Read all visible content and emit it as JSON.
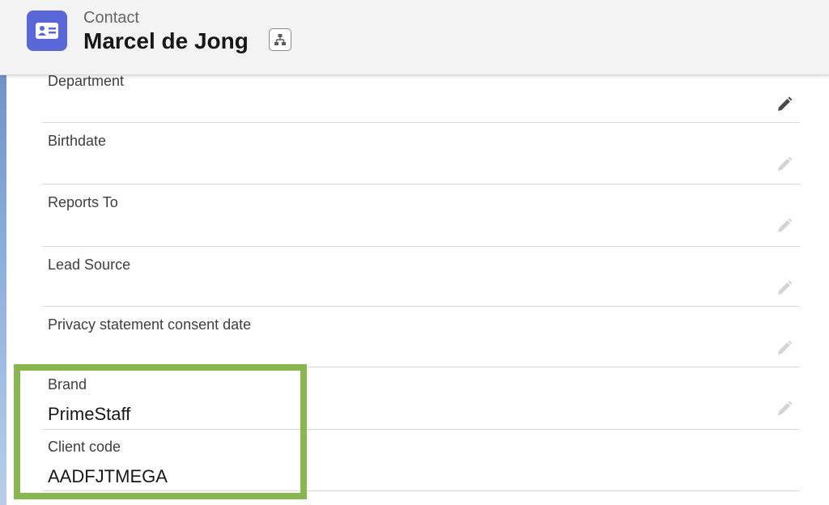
{
  "header": {
    "object_label": "Contact",
    "record_name": "Marcel de Jong",
    "record_icon": "contact-card-icon",
    "hierarchy_icon": "hierarchy-icon",
    "accent_color": "#5a67d8"
  },
  "fields": {
    "department": {
      "label": "Department",
      "value": ""
    },
    "birthdate": {
      "label": "Birthdate",
      "value": ""
    },
    "reports_to": {
      "label": "Reports To",
      "value": ""
    },
    "lead_source": {
      "label": "Lead Source",
      "value": ""
    },
    "privacy_consent_date": {
      "label": "Privacy statement consent date",
      "value": ""
    },
    "brand": {
      "label": "Brand",
      "value": "PrimeStaff"
    },
    "client_code": {
      "label": "Client code",
      "value": "AADFJTMEGA"
    }
  },
  "highlight_color": "#8ab650"
}
